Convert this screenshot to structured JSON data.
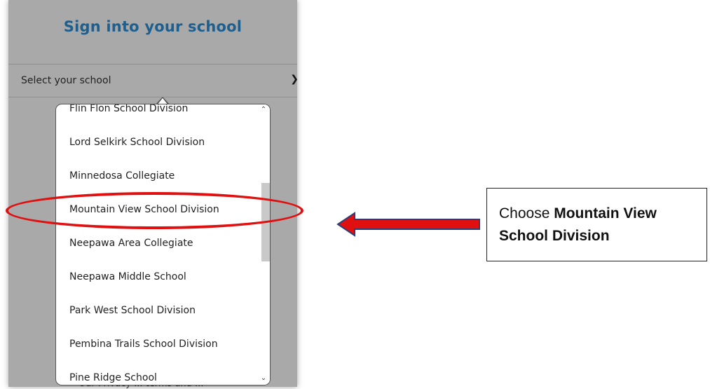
{
  "panel": {
    "title": "Sign into your school",
    "select_placeholder": "Select your school",
    "bottom_partial_text": "Our Privacy ... terms and ..."
  },
  "dropdown": {
    "items": [
      {
        "label": "Flin Flon School Division"
      },
      {
        "label": "Lord Selkirk School Division"
      },
      {
        "label": "Minnedosa Collegiate"
      },
      {
        "label": "Mountain View School Division"
      },
      {
        "label": "Neepawa Area Collegiate"
      },
      {
        "label": "Neepawa Middle School"
      },
      {
        "label": "Park West School Division"
      },
      {
        "label": "Pembina Trails School Division"
      },
      {
        "label": "Pine Ridge School"
      }
    ],
    "highlighted": "Mountain View School Division",
    "scroll_position": 0.35
  },
  "callout": {
    "prefix": "Choose ",
    "emphasis": "Mountain View School Division"
  },
  "colors": {
    "title": "#1f5f8e",
    "annotation": "#e01010",
    "panel_bg": "#a9a9a9"
  }
}
